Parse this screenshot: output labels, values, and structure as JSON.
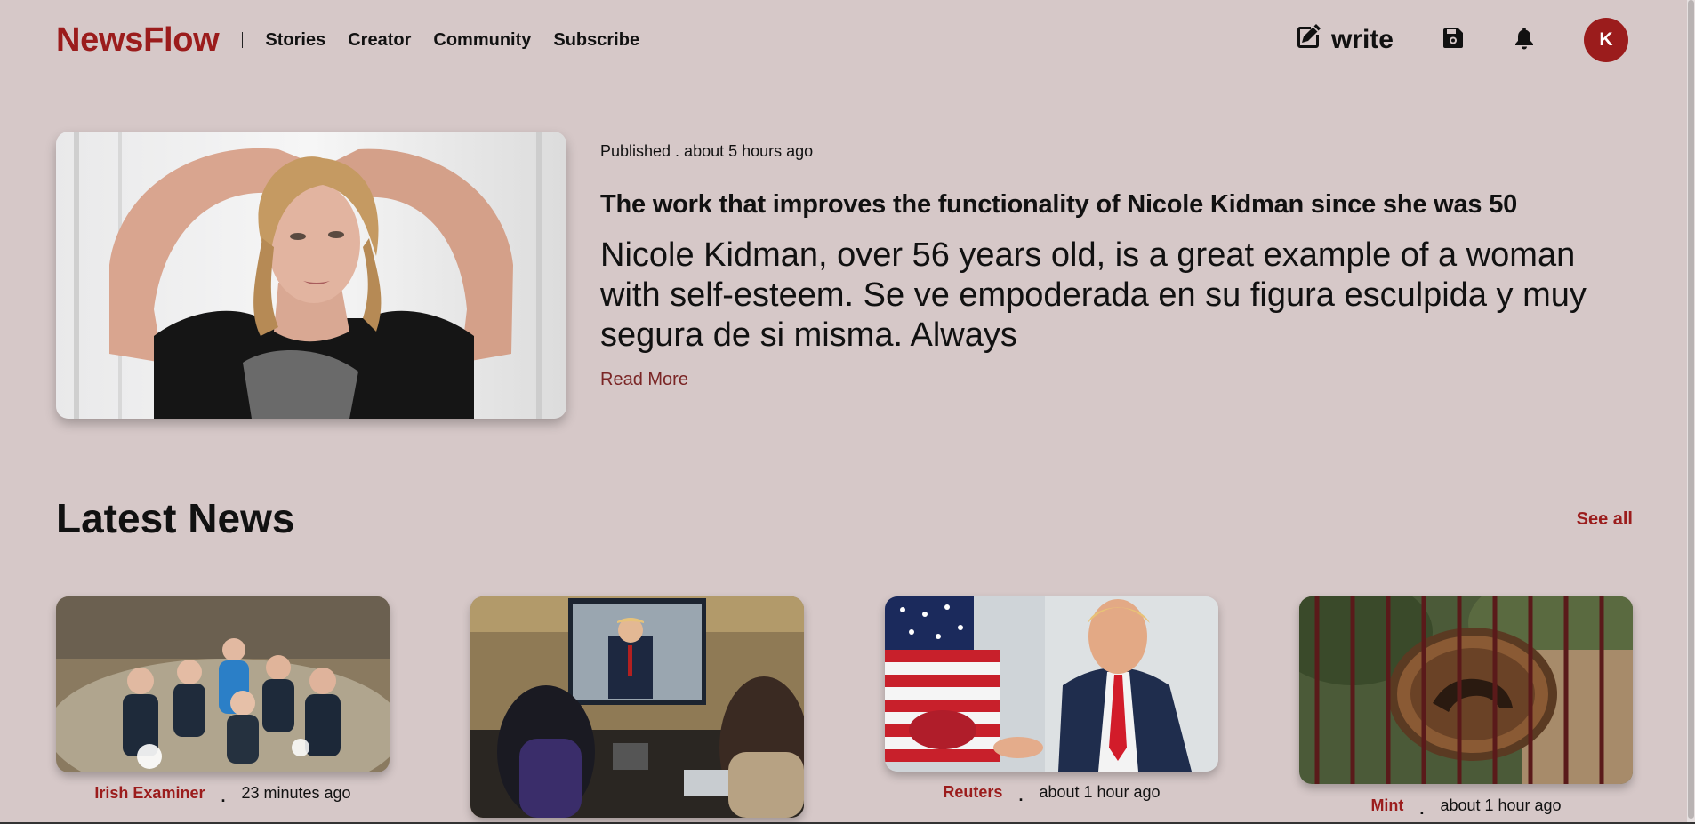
{
  "header": {
    "logo": "NewsFlow",
    "nav": [
      "Stories",
      "Creator",
      "Community",
      "Subscribe"
    ],
    "write_label": "write",
    "avatar_initial": "K",
    "brand_color": "#9b1c1c"
  },
  "hero": {
    "published": "Published . about 5 hours ago",
    "title": "The work that improves the functionality of Nicole Kidman since she was 50",
    "body": "Nicole Kidman, over 56 years old, is a great example of a woman with self-esteem. Se ve empoderada en su figura esculpida y muy segura de si misma. Always",
    "read_more": "Read More"
  },
  "latest": {
    "title": "Latest News",
    "see_all": "See all",
    "cards": [
      {
        "source": "Irish Examiner",
        "dot": ".",
        "time": "23 minutes ago"
      },
      {
        "source": "",
        "dot": "",
        "time": ""
      },
      {
        "source": "Reuters",
        "dot": ".",
        "time": "about 1 hour ago"
      },
      {
        "source": "Mint",
        "dot": ".",
        "time": "about 1 hour ago"
      }
    ]
  }
}
